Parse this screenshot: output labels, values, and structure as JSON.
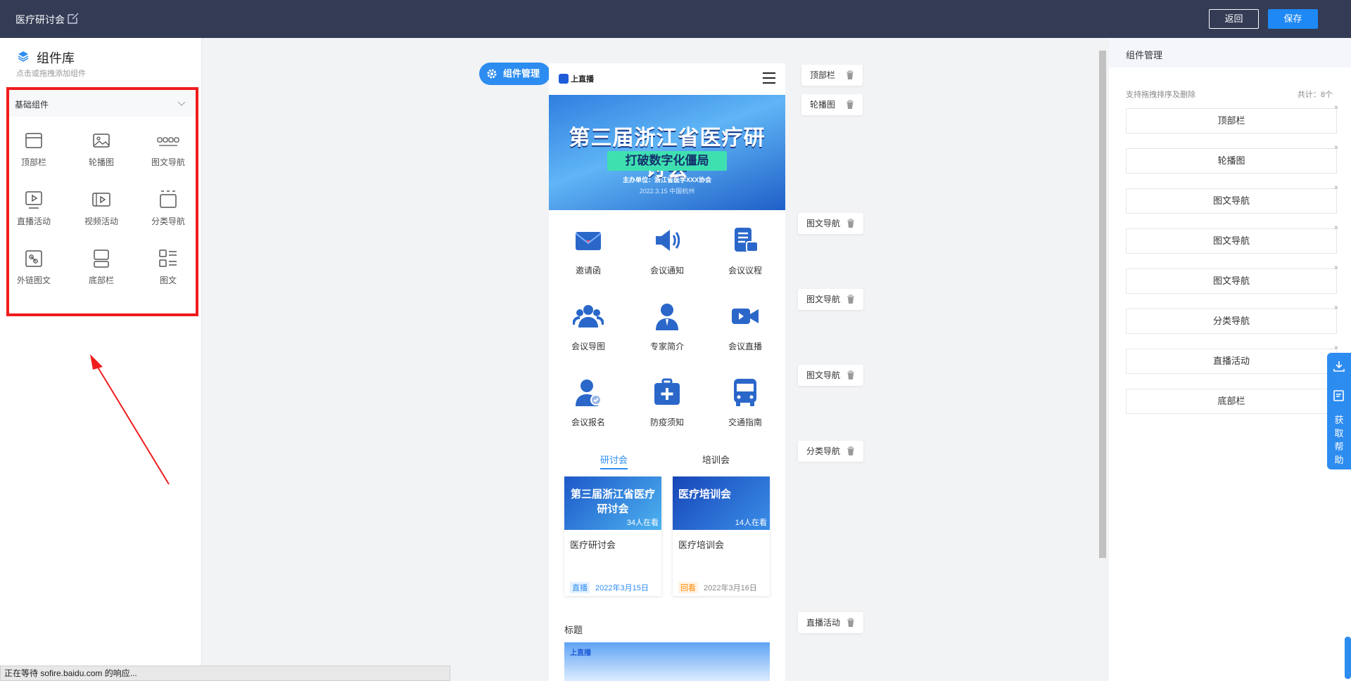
{
  "topbar": {
    "title": "医疗研讨会",
    "back_label": "返回",
    "save_label": "保存"
  },
  "library": {
    "title": "组件库",
    "subtitle": "点击或拖拽添加组件",
    "group_label": "基础组件",
    "items": [
      {
        "label": "顶部栏",
        "icon": "topbar-icon"
      },
      {
        "label": "轮播图",
        "icon": "carousel-icon"
      },
      {
        "label": "图文导航",
        "icon": "nav-dots-icon"
      },
      {
        "label": "直播活动",
        "icon": "live-icon"
      },
      {
        "label": "视频活动",
        "icon": "video-icon"
      },
      {
        "label": "分类导航",
        "icon": "category-icon"
      },
      {
        "label": "外链图文",
        "icon": "link-icon"
      },
      {
        "label": "底部栏",
        "icon": "bottombar-icon"
      },
      {
        "label": "图文",
        "icon": "list-icon"
      }
    ]
  },
  "canvas": {
    "manage_pill": "组件管理",
    "phone": {
      "logo": "上直播",
      "banner": {
        "title": "第三届浙江省医疗研讨会",
        "tag": "打破数字化僵局",
        "host": "主办单位：浙江省医学XXX协会",
        "date": "2022.3.15 中国杭州"
      },
      "nav_items": [
        {
          "label": "邀请函",
          "icon": "envelope-icon"
        },
        {
          "label": "会议通知",
          "icon": "speaker-icon"
        },
        {
          "label": "会议议程",
          "icon": "agenda-icon"
        },
        {
          "label": "会议导图",
          "icon": "group-icon"
        },
        {
          "label": "专家简介",
          "icon": "expert-icon"
        },
        {
          "label": "会议直播",
          "icon": "camera-icon"
        },
        {
          "label": "会议报名",
          "icon": "register-icon"
        },
        {
          "label": "防疫须知",
          "icon": "medkit-icon"
        },
        {
          "label": "交通指南",
          "icon": "bus-icon"
        }
      ],
      "tabs": [
        "研讨会",
        "培训会"
      ],
      "cards": [
        {
          "thumb": "第三届浙江省医疗研讨会",
          "viewers": "34人在看",
          "title": "医疗研讨会",
          "status": "直播",
          "date": "2022年3月15日"
        },
        {
          "thumb": "医疗培训会",
          "viewers": "14人在看",
          "title": "医疗培训会",
          "status": "回看",
          "date": "2022年3月16日"
        }
      ],
      "section_title": "标题",
      "bottom_logo": "上直播"
    },
    "tags": [
      "顶部栏",
      "轮播图",
      "图文导航",
      "图文导航",
      "图文导航",
      "分类导航",
      "直播活动"
    ]
  },
  "manager": {
    "title": "组件管理",
    "hint": "支持拖拽排序及删除",
    "count": "共计：8个",
    "items": [
      "顶部栏",
      "轮播图",
      "图文导航",
      "图文导航",
      "图文导航",
      "分类导航",
      "直播活动",
      "底部栏"
    ],
    "help_label": "获取帮助"
  },
  "status_bar": "正在等待 sofire.baidu.com 的响应..."
}
